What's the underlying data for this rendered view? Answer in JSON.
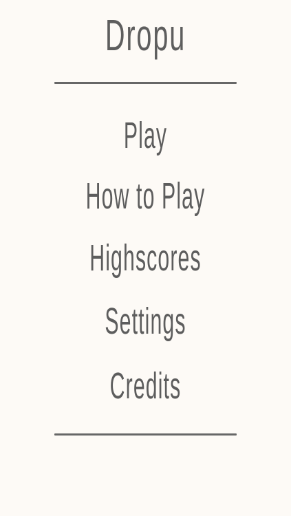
{
  "app": {
    "title": "Dropu"
  },
  "menu": {
    "items": [
      {
        "label": "Play"
      },
      {
        "label": "How to Play"
      },
      {
        "label": "Highscores"
      },
      {
        "label": "Settings"
      },
      {
        "label": "Credits"
      }
    ]
  },
  "colors": {
    "background": "#fdfaf6",
    "text": "#5d5d5d",
    "divider": "#676767"
  }
}
